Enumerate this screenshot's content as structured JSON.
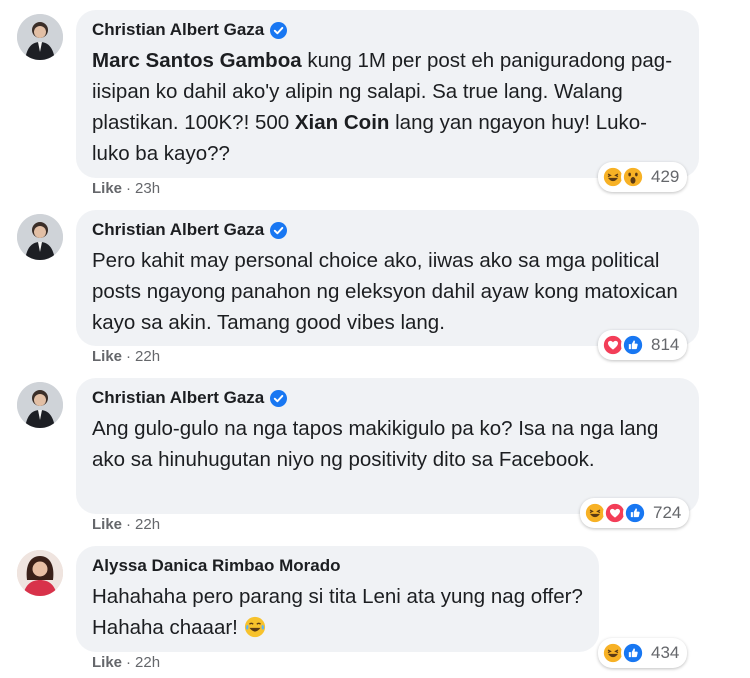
{
  "comments": [
    {
      "author": "Christian Albert Gaza",
      "verified": true,
      "segments": [
        {
          "text": "Marc Santos Gamboa",
          "bold": true
        },
        {
          "text": " kung 1M per post eh paniguradong pag-iisipan ko dahil ako'y alipin ng salapi. Sa true lang. Walang plastikan. 100K?! 500 ",
          "bold": false
        },
        {
          "text": "Xian Coin",
          "bold": true
        },
        {
          "text": " lang yan ngayon huy! Luko-luko ba kayo??",
          "bold": false
        }
      ],
      "like_label": "Like",
      "time": "23h",
      "reactions": [
        "haha-icon",
        "wow-icon"
      ],
      "reaction_count": "429"
    },
    {
      "author": "Christian Albert Gaza",
      "verified": true,
      "segments": [
        {
          "text": "Pero kahit may personal choice ako, iiwas ako sa mga political posts ngayong panahon ng eleksyon dahil ayaw kong matoxican kayo sa akin. Tamang good vibes lang.",
          "bold": false
        }
      ],
      "like_label": "Like",
      "time": "22h",
      "reactions": [
        "heart-icon",
        "like-icon"
      ],
      "reaction_count": "814"
    },
    {
      "author": "Christian Albert Gaza",
      "verified": true,
      "segments": [
        {
          "text": "Ang gulo-gulo na nga tapos makikigulo pa ko? Isa na nga lang ako sa hinuhugutan niyo ng positivity dito sa Facebook.",
          "bold": false
        }
      ],
      "like_label": "Like",
      "time": "22h",
      "reactions": [
        "haha-icon",
        "heart-icon",
        "like-icon"
      ],
      "reaction_count": "724"
    },
    {
      "author": "Alyssa Danica Rimbao Morado",
      "verified": false,
      "segments": [
        {
          "text": "Hahahaha pero parang si tita Leni ata yung nag offer? Hahaha chaaar! ",
          "bold": false
        }
      ],
      "trailing_emoji": "tears-of-joy-emoji",
      "like_label": "Like",
      "time": "22h",
      "reactions": [
        "haha-icon",
        "like-icon"
      ],
      "reaction_count": "434"
    }
  ],
  "colors": {
    "bubble": "#f0f2f5",
    "meta_text": "#65676b",
    "verified_blue": "#1877f2",
    "like_blue": "#1877f2",
    "heart_red": "#f33e58",
    "haha_yellow": "#f7b125"
  }
}
